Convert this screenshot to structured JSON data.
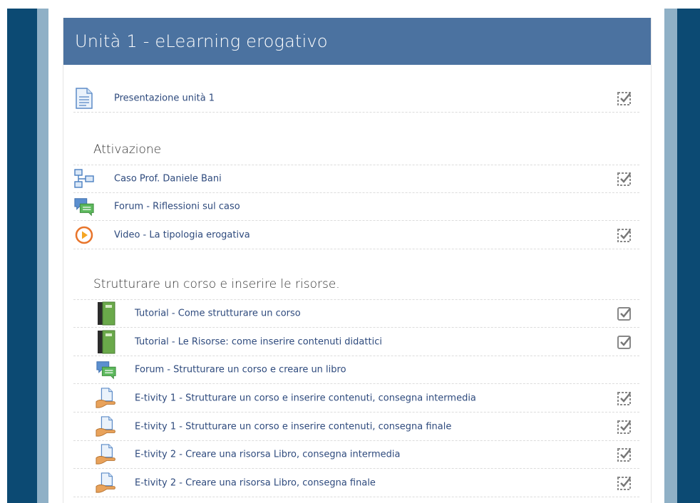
{
  "header": {
    "title": "Unità 1 - eLearning erogativo"
  },
  "top_items": [
    {
      "label": "Presentazione unità 1",
      "icon": "page-icon",
      "check": "auto"
    }
  ],
  "sections": [
    {
      "title": "Attivazione",
      "items": [
        {
          "label": "Caso Prof. Daniele Bani",
          "icon": "hierarchy-icon",
          "check": "auto"
        },
        {
          "label": "Forum - Riflessioni sul caso",
          "icon": "forum-icon",
          "check": "none"
        },
        {
          "label": "Video - La tipologia erogativa",
          "icon": "video-icon",
          "check": "auto"
        }
      ]
    },
    {
      "title": "Strutturare un corso e inserire le risorse.",
      "items": [
        {
          "label": "Tutorial - Come strutturare un corso",
          "icon": "book-icon",
          "check": "manual"
        },
        {
          "label": "Tutorial - Le Risorse: come inserire contenuti didattici",
          "icon": "book-icon",
          "check": "manual"
        },
        {
          "label": "Forum - Strutturare un corso e creare un libro",
          "icon": "forum-icon",
          "check": "none"
        },
        {
          "label": "E-tivity 1 - Strutturare un corso e inserire contenuti, consegna intermedia",
          "icon": "assignment-icon",
          "check": "auto"
        },
        {
          "label": "E-tivity 1 - Strutturare un corso e inserire contenuti, consegna finale",
          "icon": "assignment-icon",
          "check": "auto"
        },
        {
          "label": "E-tivity 2 - Creare una risorsa Libro, consegna intermedia",
          "icon": "assignment-icon",
          "check": "auto"
        },
        {
          "label": "E-tivity 2 - Creare una risorsa Libro, consegna finale",
          "icon": "assignment-icon",
          "check": "auto"
        }
      ]
    }
  ],
  "colors": {
    "header_bg": "#4b72a0",
    "side_dark": "#0c4a73",
    "side_light": "#8fb0c6",
    "link": "#2e4a7d"
  }
}
